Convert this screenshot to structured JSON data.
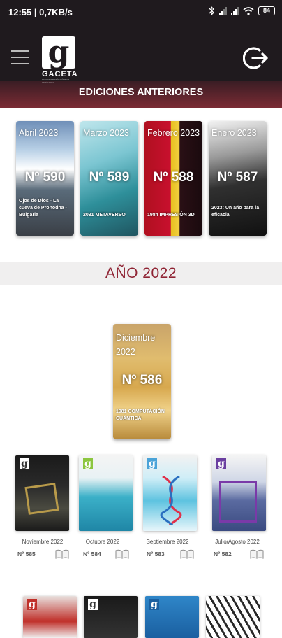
{
  "status_bar": {
    "time_net": "12:55 | 0,7KB/s",
    "battery": "84"
  },
  "header": {
    "logo_word": "GACETA",
    "logo_sub": "DE OPTOMETRÍA Y ÓPTICA OFTÁLMICA",
    "section_title": "EDICIONES ANTERIORES"
  },
  "editions_2023": [
    {
      "month": "Abril 2023",
      "number": "Nº 590",
      "caption": "Ojos de Dios - La cueva de Prohodna - Bulgaria"
    },
    {
      "month": "Marzo 2023",
      "number": "Nº 589",
      "caption": "2031 METAVERSO"
    },
    {
      "month": "Febrero 2023",
      "number": "Nº 588",
      "caption": "1984 IMPRESIÓN 3D"
    },
    {
      "month": "Enero 2023",
      "number": "Nº 587",
      "caption": "2023: Un año para la eficacia"
    }
  ],
  "year_2022": {
    "label": "AÑO 2022",
    "featured": {
      "month": "Diciembre 2022",
      "number": "Nº 586",
      "caption": "1981 COMPUTACIÓN CUÁNTICA"
    },
    "issues": [
      {
        "month": "Noviembre 2022",
        "number": "Nº 585"
      },
      {
        "month": "Octubre 2022",
        "number": "Nº 584"
      },
      {
        "month": "Septiembre 2022",
        "number": "Nº 583"
      },
      {
        "month": "Julio/Agosto 2022",
        "number": "Nº 582"
      }
    ]
  }
}
